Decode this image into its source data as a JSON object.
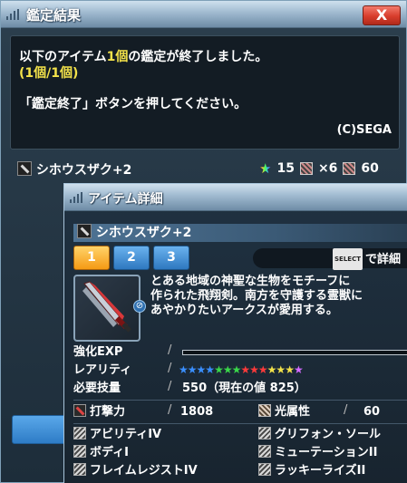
{
  "result_window": {
    "title": "鑑定結果",
    "close_label": "X",
    "message": {
      "line1_pre": "以下のアイテム",
      "line1_count": "1個",
      "line1_post": "の鑑定が終了しました。",
      "line2": "(1個/1個)",
      "line3": "「鑑定終了」ボタンを押してください。",
      "credit": "(C)SEGA"
    },
    "item": {
      "name": "シホウスザク+2",
      "rarity_value": "15",
      "slots_value": "×6",
      "element_value": "60"
    }
  },
  "detail_window": {
    "title": "アイテム詳細",
    "item_name": "シホウスザク+2",
    "tabs": [
      "1",
      "2",
      "3"
    ],
    "active_tab": 0,
    "select_badge": "SELECT",
    "detail_hint": "で詳細",
    "description": [
      "とある地域の神聖な生物をモチーフに",
      "作られた飛翔剣。南方を守護する霊獣に",
      "あやかりたいアークスが愛用する。"
    ],
    "stats": {
      "exp_label": "強化EXP",
      "rarity_label": "レアリティ",
      "rarity_stars": 14,
      "skill_label": "必要技量",
      "skill_value": "550（現在の値 825）"
    },
    "attack_label": "打撃力",
    "attack_value": "1808",
    "element_label": "光属性",
    "element_value": "60",
    "abilities": [
      "アビリティIV",
      "グリフォン・ソール",
      "ボディI",
      "ミューテーションII",
      "フレイムレジストIV",
      "ラッキーライズII"
    ],
    "colors": {
      "tab_active": "#f59a14",
      "tab_inactive": "#2e78c0",
      "highlight": "#f3e24a"
    }
  }
}
